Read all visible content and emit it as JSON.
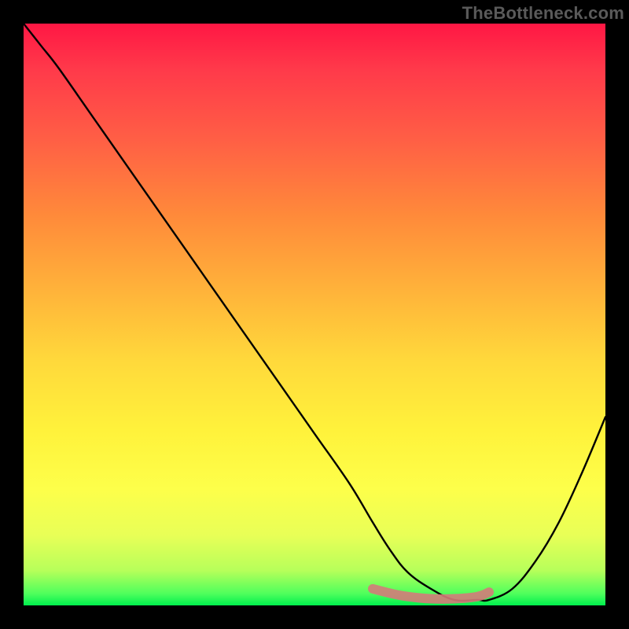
{
  "watermark": "TheBottleneck.com",
  "colors": {
    "frame": "#000000",
    "gradient_top": "#ff1744",
    "gradient_mid1": "#ffb03a",
    "gradient_mid2": "#fff23b",
    "gradient_bottom": "#00ef4e",
    "curve": "#000000",
    "highlight": "#d47b7a"
  },
  "chart_data": {
    "type": "line",
    "title": "",
    "xlabel": "",
    "ylabel": "",
    "xlim": [
      0,
      100
    ],
    "ylim": [
      0,
      105
    ],
    "grid": false,
    "series": [
      {
        "name": "bottleneck-curve",
        "x": [
          0,
          3,
          6,
          12,
          20,
          28,
          36,
          44,
          50,
          56,
          60,
          63,
          66,
          70,
          74,
          78,
          80,
          84,
          88,
          92,
          96,
          100
        ],
        "values": [
          105,
          101,
          97,
          88,
          76,
          64,
          52,
          40,
          31,
          22,
          15,
          10,
          6,
          3,
          1,
          1,
          1,
          3,
          8,
          15,
          24,
          34
        ]
      },
      {
        "name": "highlight-band",
        "x": [
          60,
          63,
          66,
          70,
          74,
          78,
          80
        ],
        "values": [
          3,
          2.2,
          1.6,
          1.2,
          1.2,
          1.6,
          2.4
        ]
      }
    ],
    "annotations": []
  }
}
